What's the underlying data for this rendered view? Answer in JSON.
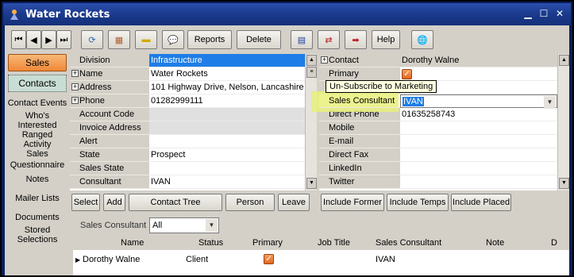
{
  "window": {
    "title": "Water Rockets"
  },
  "toolbar": {
    "reports": "Reports",
    "delete": "Delete",
    "help": "Help"
  },
  "sidebar": {
    "items": [
      {
        "label": "Sales"
      },
      {
        "label": "Contacts"
      },
      {
        "label": "Contact Events"
      },
      {
        "label": "Who's Interested Ranged"
      },
      {
        "label": "Activity Sales"
      },
      {
        "label": "Questionnaire"
      },
      {
        "label": "Notes"
      },
      {
        "label": "Mailer Lists"
      },
      {
        "label": "Documents"
      },
      {
        "label": "Stored Selections"
      }
    ]
  },
  "company": {
    "fields": [
      {
        "label": "Division",
        "value": "Infrastructure"
      },
      {
        "label": "Name",
        "value": "Water Rockets"
      },
      {
        "label": "Address",
        "value": "101 Highway Drive, Nelson, Lancashire"
      },
      {
        "label": "Phone",
        "value": "01282999111"
      },
      {
        "label": "Account Code",
        "value": ""
      },
      {
        "label": "Invoice Address",
        "value": ""
      },
      {
        "label": "Alert",
        "value": ""
      },
      {
        "label": "State",
        "value": "Prospect"
      },
      {
        "label": "Sales State",
        "value": ""
      },
      {
        "label": "Consultant",
        "value": "IVAN"
      }
    ]
  },
  "contact": {
    "fields": [
      {
        "label": "Contact",
        "value": "Dorothy Walne"
      },
      {
        "label": "Primary",
        "value": ""
      },
      {
        "label": "",
        "value": ""
      },
      {
        "label": "Sales Consultant",
        "value": "IVAN"
      },
      {
        "label": "Direct Phone",
        "value": "01635258743"
      },
      {
        "label": "Mobile",
        "value": ""
      },
      {
        "label": "E-mail",
        "value": ""
      },
      {
        "label": "Direct Fax",
        "value": ""
      },
      {
        "label": "LinkedIn",
        "value": ""
      },
      {
        "label": "Twitter",
        "value": ""
      }
    ],
    "tooltip": "Un-Subscribe to Marketing"
  },
  "actions": {
    "select": "Select",
    "add": "Add",
    "contact_tree": "Contact Tree",
    "person": "Person",
    "leave": "Leave",
    "include_former": "Include Former",
    "include_temps": "Include Temps",
    "include_placed": "Include Placed"
  },
  "filter": {
    "label": "Sales Consultant",
    "value": "All"
  },
  "list": {
    "columns": [
      "Name",
      "Status",
      "Primary",
      "Job Title",
      "Sales Consultant",
      "Note",
      "D"
    ],
    "rows": [
      {
        "name": "Dorothy Walne",
        "status": "Client",
        "primary": true,
        "job_title": "",
        "sales_consultant": "IVAN",
        "note": ""
      }
    ]
  },
  "colors": {
    "accent": "#f08838",
    "selection": "#1e7de6",
    "titlebar": "#1b3a8c"
  }
}
